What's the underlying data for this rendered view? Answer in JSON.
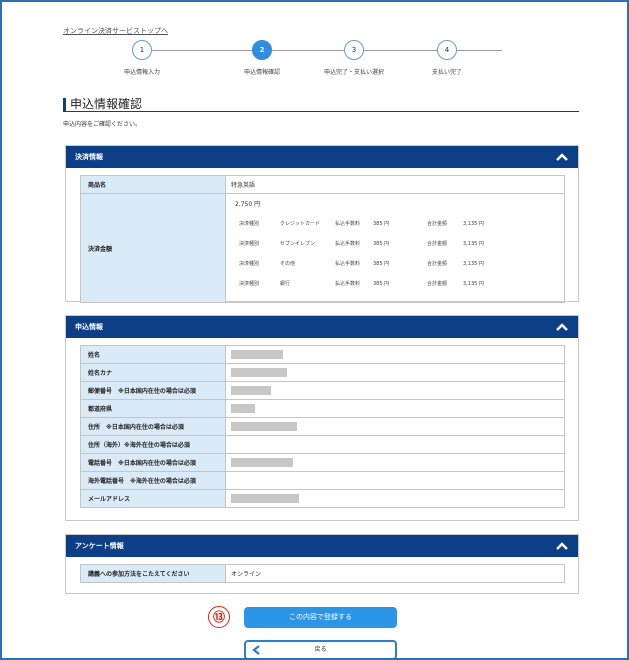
{
  "top_link": "オンライン決済サービストップへ",
  "steps": [
    {
      "num": "1",
      "label": "申込情報入力"
    },
    {
      "num": "2",
      "label": "申込情報確認"
    },
    {
      "num": "3",
      "label": "申込完了・支払い選択"
    },
    {
      "num": "4",
      "label": "支払い完了"
    }
  ],
  "page_title": "申込情報確認",
  "page_desc": "申込内容をご確認ください。",
  "sections": {
    "payment": {
      "title": "決済情報",
      "product_label": "商品名",
      "product_value": "特急英語",
      "amount_label": "決済金額",
      "amount_total": "2,750 円",
      "rows": [
        {
          "kind": "決済種別",
          "method": "クレジットカード",
          "fee_label": "払込手数料",
          "fee": "385 円",
          "sum_label": "合計金額",
          "sum": "3,135 円"
        },
        {
          "kind": "決済種別",
          "method": "セブンイレブン",
          "fee_label": "払込手数料",
          "fee": "385 円",
          "sum_label": "合計金額",
          "sum": "3,135 円"
        },
        {
          "kind": "決済種別",
          "method": "その他",
          "fee_label": "払込手数料",
          "fee": "385 円",
          "sum_label": "合計金額",
          "sum": "3,135 円"
        },
        {
          "kind": "決済種別",
          "method": "銀行",
          "fee_label": "払込手数料",
          "fee": "385 円",
          "sum_label": "合計金額",
          "sum": "3,135 円"
        }
      ]
    },
    "applicant": {
      "title": "申込情報",
      "fields": [
        "姓名",
        "姓名カナ",
        "郵便番号　※日本国内在住の場合は必須",
        "都道府県",
        "住所　※日本国内在住の場合は必須",
        "住所（海外）※海外在住の場合は必須",
        "電話番号　※日本国内在住の場合は必須",
        "海外電話番号　※海外在住の場合は必須",
        "メールアドレス"
      ]
    },
    "survey": {
      "title": "アンケート情報",
      "question": "講義への参加方法をこたえてください",
      "answer": "オンライン"
    }
  },
  "marker": "⑬",
  "submit_label": "この内容で登録する",
  "back_label": "戻る",
  "colors": {
    "header": "#0d3f87",
    "primary": "#2b96e6",
    "label_bg": "#dbeaf7",
    "marker": "#dd2211"
  }
}
